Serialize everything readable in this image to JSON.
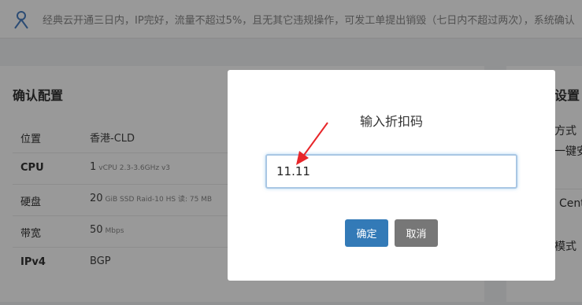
{
  "notice": {
    "icon": "user-icon",
    "text": "经典云开通三日内，IP完好，流量不超过5%，且无其它违规操作，可发工单提出销毁（七日内不超过两次），系统确认"
  },
  "config": {
    "title": "确认配置",
    "rows": [
      {
        "key": "位置",
        "value": "香港-CLD",
        "detail": ""
      },
      {
        "key": "CPU",
        "value": "1",
        "detail": "vCPU 2.3-3.6GHz v3"
      },
      {
        "key": "硬盘",
        "value": "20",
        "detail": "GiB SSD Raid-10 HS 读: 75 MB"
      },
      {
        "key": "带宽",
        "value": "50",
        "detail": "Mbps"
      },
      {
        "key": "IPv4",
        "value": "BGP",
        "detail": ""
      }
    ]
  },
  "right_panel": {
    "title_fragment": "设置",
    "line1": "方式",
    "line2": "一键安",
    "line3": "Cent",
    "line4": "模式"
  },
  "modal": {
    "title": "输入折扣码",
    "input_value": "11.11",
    "ok_label": "确定",
    "cancel_label": "取消"
  },
  "colors": {
    "primary": "#337ab7",
    "secondary": "#777777",
    "annotation_arrow": "#e8262a"
  }
}
